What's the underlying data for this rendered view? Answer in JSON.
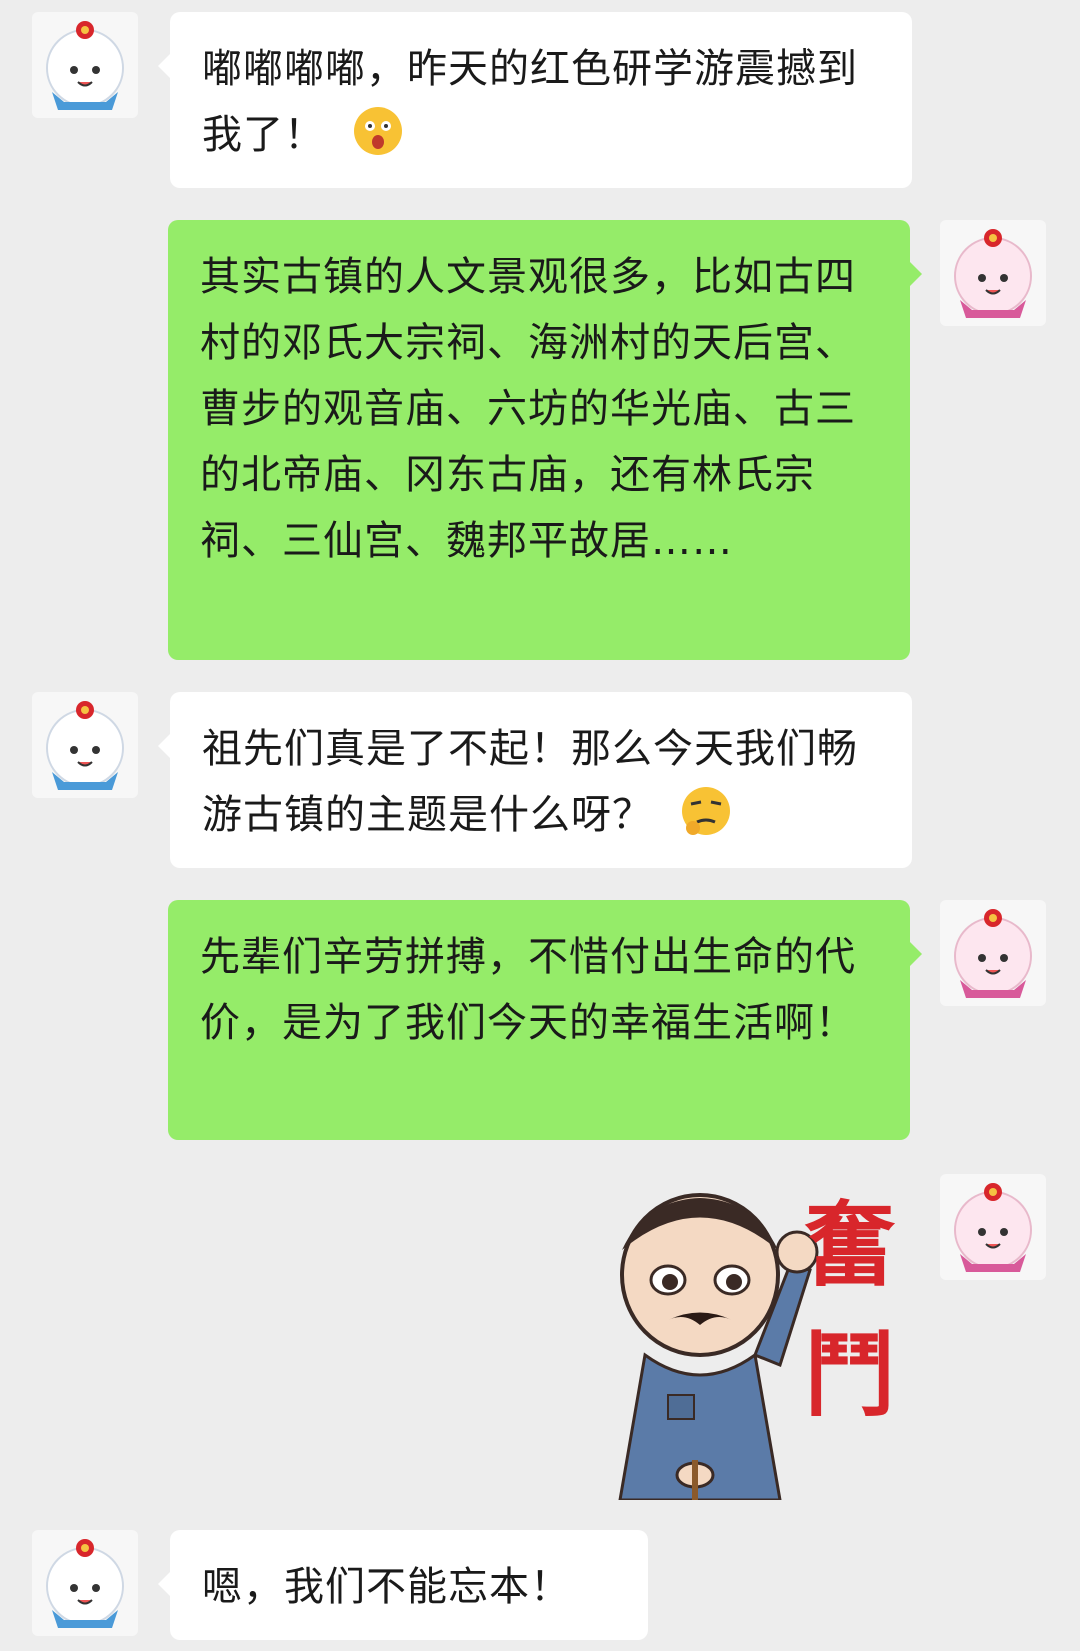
{
  "chat": {
    "messages": [
      {
        "side": "in",
        "text": "嘟嘟嘟嘟，昨天的红色研学游震撼到我了！",
        "emoji": "shocked-face-emoji"
      },
      {
        "side": "out",
        "text": "其实古镇的人文景观很多，比如古四村的邓氏大宗祠、海洲村的天后宫、曹步的观音庙、六坊的华光庙、古三的北帝庙、冈东古庙，还有林氏宗祠、三仙宫、魏邦平故居……"
      },
      {
        "side": "in",
        "text": "祖先们真是了不起！那么今天我们畅游古镇的主题是什么呀？",
        "emoji": "thinking-face-emoji"
      },
      {
        "side": "out",
        "text": "先辈们辛劳拼搏，不惜付出生命的代价，是为了我们今天的幸福生活啊！"
      },
      {
        "side": "out",
        "sticker": "fighting-revolutionary-sticker",
        "sticker_text": "奮鬥"
      },
      {
        "side": "in",
        "text": "嗯，我们不能忘本！"
      }
    ]
  },
  "colors": {
    "background": "#ededed",
    "incoming_bubble": "#ffffff",
    "outgoing_bubble": "#95ec69",
    "sticker_red": "#d8262b"
  }
}
